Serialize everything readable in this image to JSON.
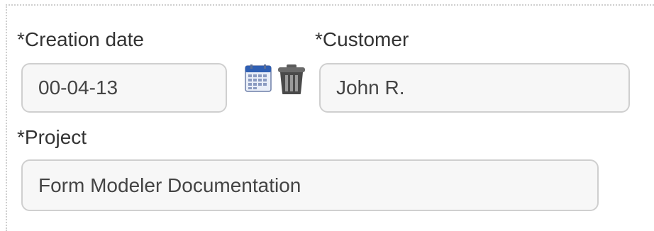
{
  "form": {
    "creation_date": {
      "label": "*Creation date",
      "value": "00-04-13"
    },
    "calendar_button": {
      "icon": "calendar-icon"
    },
    "clear_button": {
      "icon": "trash-icon"
    },
    "customer": {
      "label": "*Customer",
      "value": "John R."
    },
    "project": {
      "label": "*Project",
      "value": "Form Modeler Documentation"
    }
  },
  "colors": {
    "field_background": "#f7f7f7",
    "field_border": "#cfcfcf",
    "text": "#333333",
    "calendar_header": "#2f5fb3",
    "trash": "#4a4a4a"
  }
}
